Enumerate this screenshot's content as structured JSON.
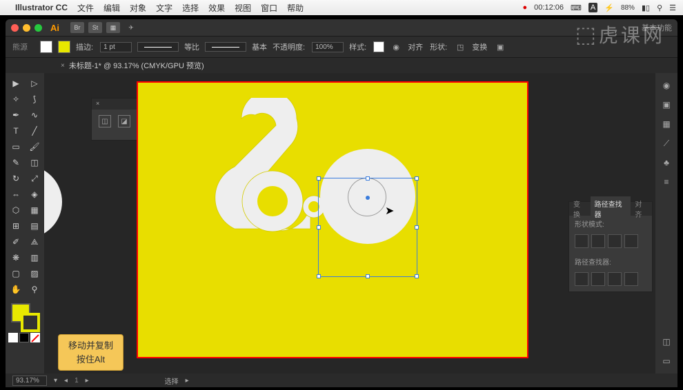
{
  "menubar": {
    "apple": "",
    "app": "Illustrator CC",
    "items": [
      "文件",
      "编辑",
      "对象",
      "文字",
      "选择",
      "效果",
      "视图",
      "窗口",
      "帮助"
    ],
    "timer": "00:12:06",
    "battery": "88%"
  },
  "titlebar": {
    "ai": "Ai",
    "basic_label": "基本功能"
  },
  "control": {
    "label_stroke": "描边:",
    "stroke_weight": "1 pt",
    "uniform_label": "等比",
    "basic_label": "基本",
    "opacity_label": "不透明度:",
    "opacity_value": "100%",
    "style_label": "样式:",
    "align_label": "对齐",
    "shape_label": "形状:",
    "transform_label": "变换"
  },
  "document": {
    "tab_title": "未标题-1* @ 93.17% (CMYK/GPU 预览)"
  },
  "pathfinder": {
    "tabs": [
      "变换",
      "路径查找器",
      "对齐"
    ],
    "shape_modes": "形状模式:",
    "pathfinders": "路径查找器:"
  },
  "status": {
    "zoom": "93.17%",
    "select": "选择"
  },
  "tooltip": {
    "line1": "移动并复制",
    "line2": "按住Alt"
  },
  "watermark": "虎课网",
  "colors": {
    "artboard": "#e8de00",
    "shape_fill": "#eeeeee",
    "selection": "#3a7cdc"
  }
}
